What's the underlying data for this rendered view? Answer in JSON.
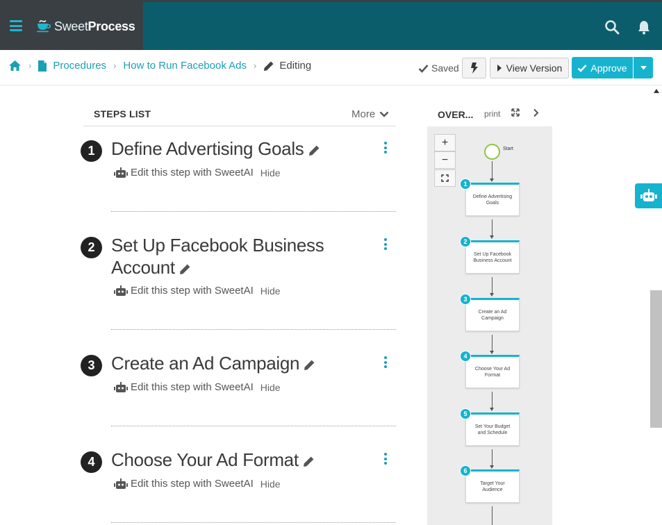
{
  "app": {
    "brand_sweet": "Sweet",
    "brand_process": "Process",
    "accent_color": "#16b3cf",
    "header_color": "#0c5d6b"
  },
  "breadcrumb": {
    "home_icon": "home-icon",
    "procedures": "Procedures",
    "procedure_name": "How to Run Facebook Ads",
    "mode": "Editing"
  },
  "toolbar": {
    "saved_label": "Saved",
    "view_version_label": "View Version",
    "approve_label": "Approve"
  },
  "steps_list": {
    "header": "STEPS LIST",
    "more_label": "More",
    "ai_label": "Edit this step with SweetAI",
    "hide_label": "Hide",
    "steps": [
      {
        "num": "1",
        "title": "Define Advertising Goals"
      },
      {
        "num": "2",
        "title": "Set Up Facebook Business Account"
      },
      {
        "num": "3",
        "title": "Create an Ad Campaign"
      },
      {
        "num": "4",
        "title": "Choose Your Ad Format"
      }
    ]
  },
  "overview": {
    "title": "OVER...",
    "print_label": "print",
    "zoom_in": "+",
    "zoom_out": "−",
    "start_label": "Start",
    "nodes": [
      {
        "num": "1",
        "label": "Define Advertising Goals"
      },
      {
        "num": "2",
        "label": "Set Up Facebook Business Account"
      },
      {
        "num": "3",
        "label": "Create an Ad Campaign"
      },
      {
        "num": "4",
        "label": "Choose Your Ad Format"
      },
      {
        "num": "5",
        "label": "Set Your Budget and Schedule"
      },
      {
        "num": "6",
        "label": "Target Your Audience"
      }
    ]
  }
}
